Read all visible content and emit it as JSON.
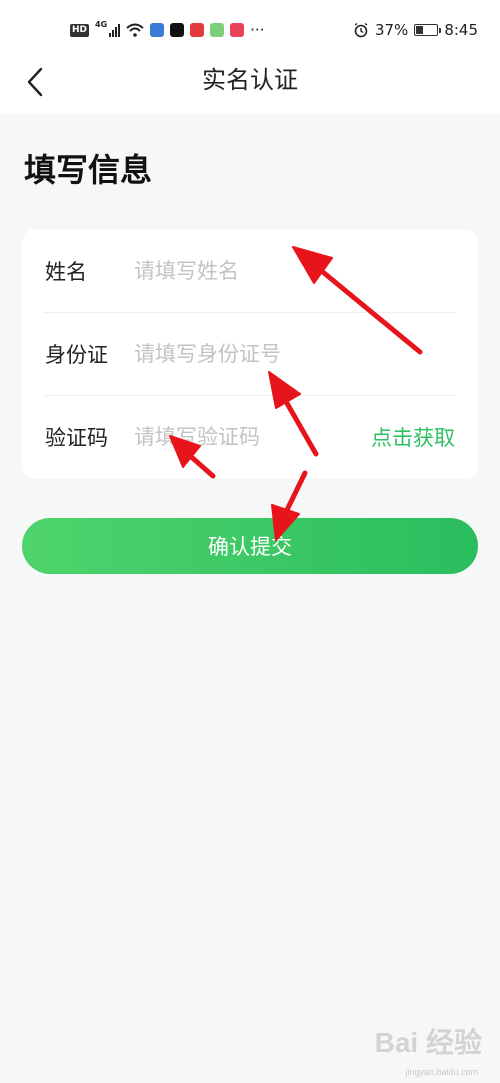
{
  "status_bar": {
    "hd_badge": "HD",
    "network": "4G",
    "more": "···",
    "battery_percent": "37%",
    "battery_level": 0.37,
    "time": "8:45"
  },
  "nav": {
    "title": "实名认证"
  },
  "heading": "填写信息",
  "form": {
    "name": {
      "label": "姓名",
      "placeholder": "请填写姓名"
    },
    "id_card": {
      "label": "身份证",
      "placeholder": "请填写身份证号"
    },
    "code": {
      "label": "验证码",
      "placeholder": "请填写验证码",
      "get_code": "点击获取"
    }
  },
  "submit_label": "确认提交",
  "colors": {
    "accent": "#2fbf62",
    "button_start": "#4fd46c",
    "button_end": "#2abd5e",
    "annotation_arrow": "#e8141b"
  },
  "watermark": {
    "main": "Bai 经验",
    "sub": "jingyan.baidu.com"
  }
}
